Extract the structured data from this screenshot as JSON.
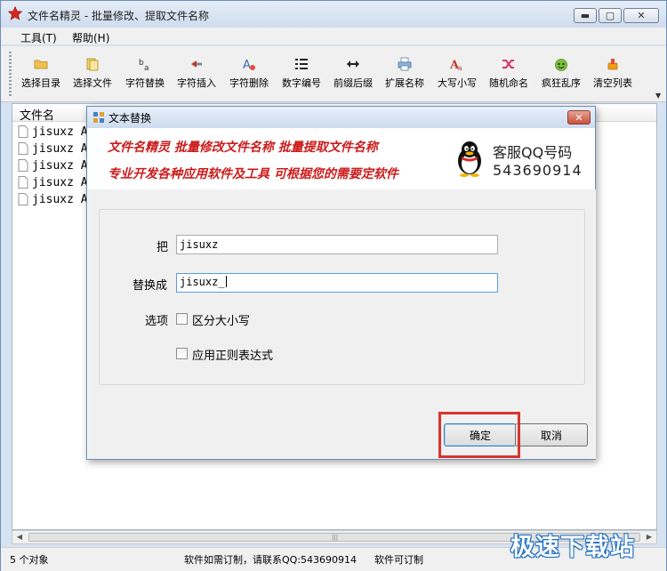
{
  "window": {
    "title": "文件名精灵 - 批量修改、提取文件名称",
    "minimize_glyph": "▬",
    "maximize_glyph": "▢",
    "close_glyph": "✕"
  },
  "menu": [
    {
      "label": "工具(T)"
    },
    {
      "label": "帮助(H)"
    }
  ],
  "toolbar": {
    "buttons": [
      {
        "label": "选择目录",
        "icon": "folder-icon"
      },
      {
        "label": "选择文件",
        "icon": "files-icon"
      },
      {
        "label": "字符替换",
        "icon": "replace-icon"
      },
      {
        "label": "字符插入",
        "icon": "insert-icon"
      },
      {
        "label": "字符删除",
        "icon": "delete-char-icon"
      },
      {
        "label": "数字编号",
        "icon": "number-list-icon"
      },
      {
        "label": "前缀后缀",
        "icon": "arrows-icon"
      },
      {
        "label": "扩展名称",
        "icon": "printer-icon"
      },
      {
        "label": "大写小写",
        "icon": "case-icon"
      },
      {
        "label": "随机命名",
        "icon": "shuffle-icon"
      },
      {
        "label": "疯狂乱序",
        "icon": "crazy-icon"
      },
      {
        "label": "清空列表",
        "icon": "clear-icon"
      }
    ]
  },
  "file_list": {
    "column_header": "文件名",
    "rows": [
      "jisuxz A",
      "jisuxz A",
      "jisuxz A",
      "jisuxz A",
      "jisuxz A"
    ]
  },
  "status": {
    "count": "5 个对象",
    "contact": "软件如需订制，请联系QQ:543690914",
    "custom": "软件可订制",
    "scroll_grip": "|||"
  },
  "watermark": "极速下载站",
  "dialog": {
    "title": "文本替换",
    "close_glyph": "✕",
    "banner": {
      "line1": "文件名精灵  批量修改文件名称  批量提取文件名称",
      "line2": "专业开发各种应用软件及工具 可根据您的需要定软件",
      "qq_label": "客服QQ号码",
      "qq_number": "543690914"
    },
    "find_label": "把",
    "find_value": "jisuxz",
    "replace_label": "替换成",
    "replace_value": "jisuxz_",
    "options_label": "选项",
    "case_label": "区分大小写",
    "case_checked": false,
    "regex_label": "应用正则表达式",
    "regex_checked": false,
    "ok_label": "确定",
    "cancel_label": "取消"
  },
  "colors": {
    "banner_text": "#cc1b1b",
    "highlight": "#d8352c"
  }
}
